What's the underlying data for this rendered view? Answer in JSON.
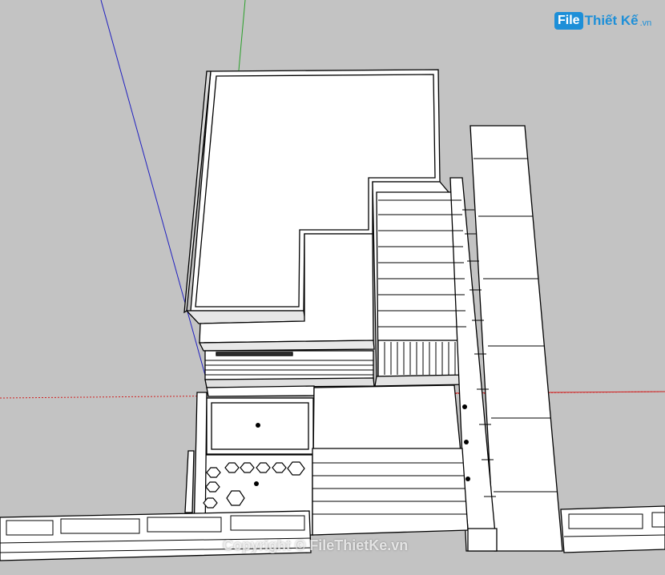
{
  "logo": {
    "badge": "File",
    "name": "Thiết Kế",
    "tld": ".vn"
  },
  "watermark": "Copyright © FileThietKe.vn",
  "colors": {
    "background": "#c3c3c3",
    "axis_green": "#2aa02a",
    "axis_blue": "#2020c0",
    "axis_red": "#d02020",
    "brand": "#1d8fd8"
  }
}
